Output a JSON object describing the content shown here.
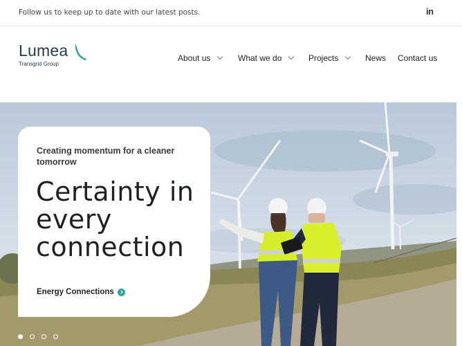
{
  "topbar": {
    "follow_text": "Follow us to keep up to date with our latest posts.",
    "social_icon": "linkedin-icon",
    "social_label": "in"
  },
  "brand": {
    "name": "Lumea",
    "subtitle": "Transgrid Group",
    "accent": "#2aa59a"
  },
  "nav": {
    "items": [
      {
        "label": "About us",
        "has_dropdown": true
      },
      {
        "label": "What we do",
        "has_dropdown": true
      },
      {
        "label": "Projects",
        "has_dropdown": true
      },
      {
        "label": "News",
        "has_dropdown": false
      },
      {
        "label": "Contact us",
        "has_dropdown": false
      }
    ]
  },
  "hero": {
    "tagline": "Creating momentum for a cleaner tomorrow",
    "headline": "Certainty in every connection",
    "cta_label": "Energy Connections",
    "slides": {
      "count": 4,
      "active": 1
    }
  }
}
